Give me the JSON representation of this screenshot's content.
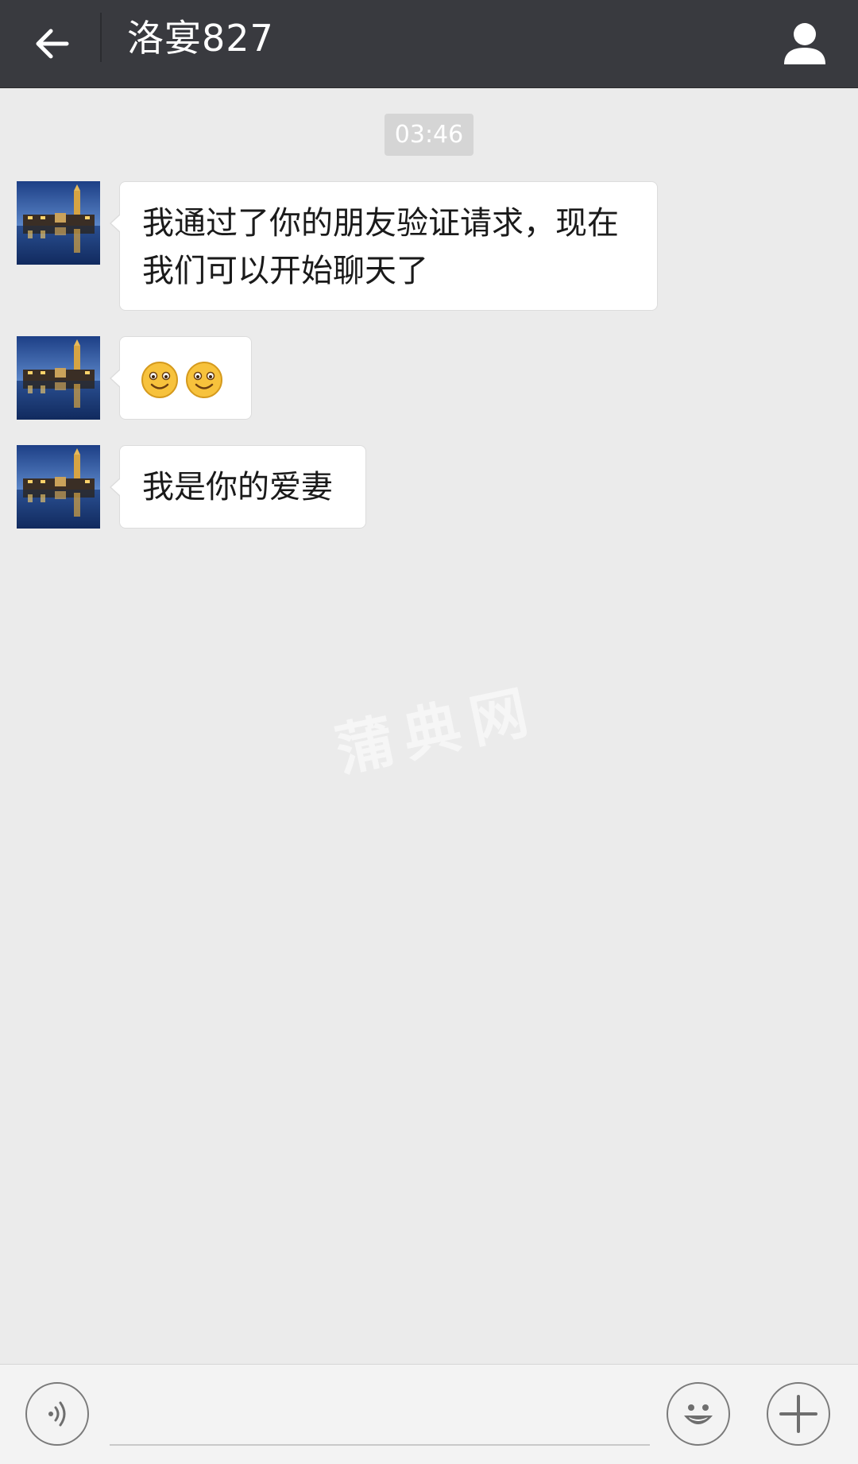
{
  "header": {
    "title": "洛宴827",
    "back_icon": "arrow-left-icon",
    "profile_icon": "person-icon",
    "background_color": "#393a3f"
  },
  "chat": {
    "timestamp": "03:46",
    "messages": [
      {
        "sender": "contact",
        "type": "text",
        "lines": [
          "我通过了你的朋友验证请求，现在",
          "我们可以开始聊天了"
        ]
      },
      {
        "sender": "contact",
        "type": "emoji",
        "emojis": [
          "smile-emoji",
          "smile-emoji"
        ]
      },
      {
        "sender": "contact",
        "type": "text",
        "lines": [
          "我是你的爱妻"
        ]
      }
    ],
    "avatar_icon": "night-city-avatar"
  },
  "watermark": "蒲典网",
  "input_bar": {
    "voice_icon": "voice-icon",
    "emoji_icon": "emoji-icon",
    "plus_icon": "plus-icon",
    "input_value": "",
    "input_placeholder": ""
  },
  "colors": {
    "chat_background": "#ebebeb",
    "bubble_background": "#ffffff",
    "input_bar_background": "#f3f3f3"
  }
}
